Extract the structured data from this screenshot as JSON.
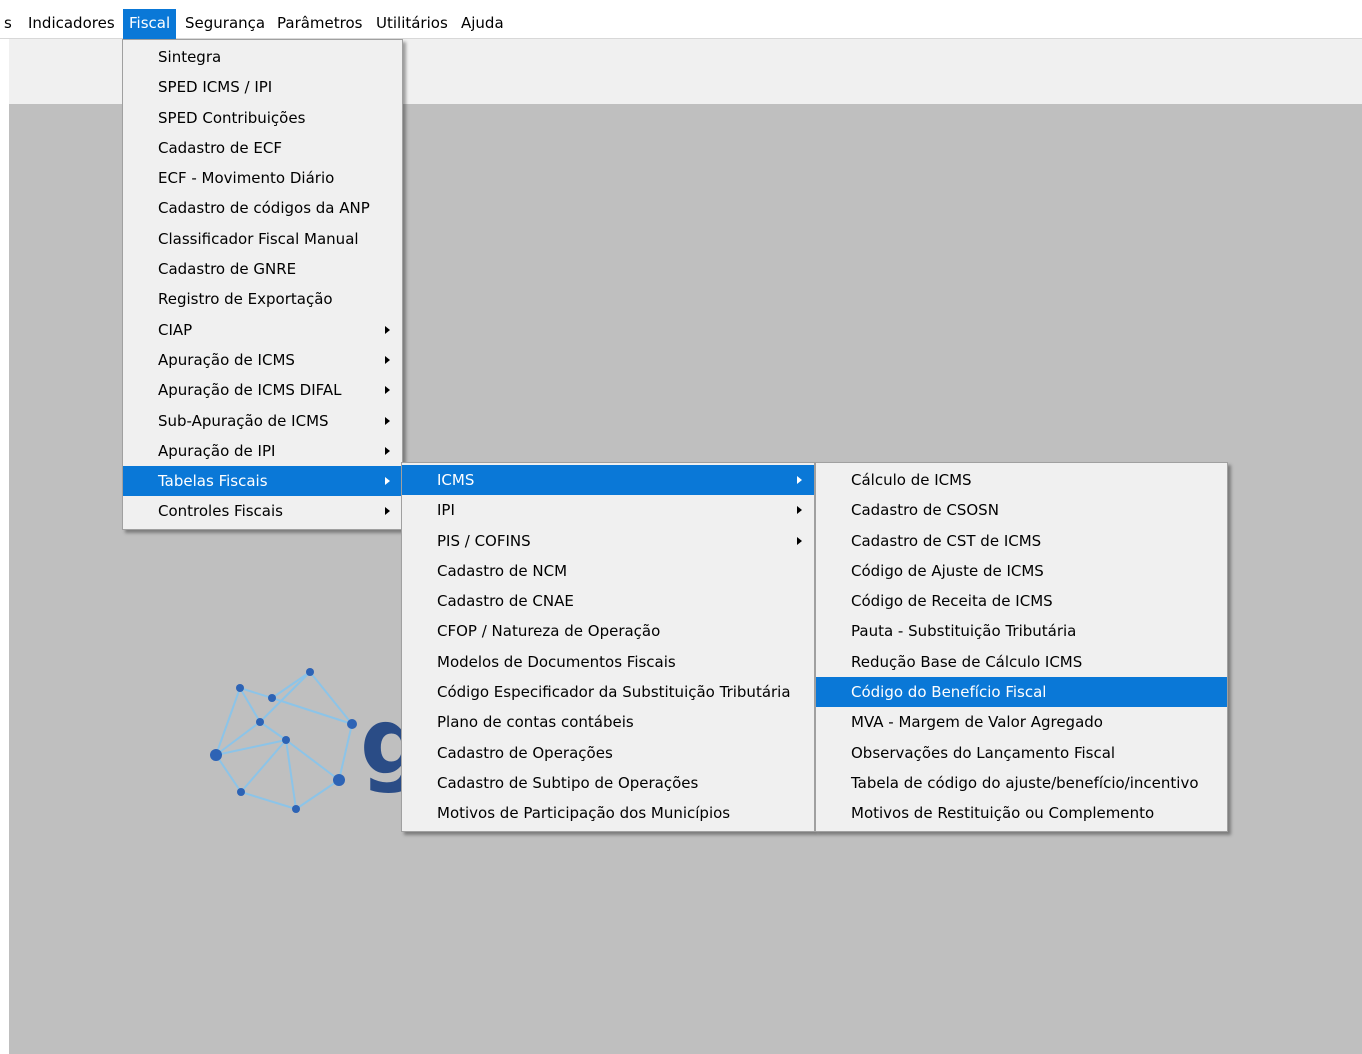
{
  "menubar": {
    "items": [
      {
        "label": "s"
      },
      {
        "label": "Indicadores"
      },
      {
        "label": "Fiscal"
      },
      {
        "label": "Segurança"
      },
      {
        "label": "Parâmetros"
      },
      {
        "label": "Utilitários"
      },
      {
        "label": "Ajuda"
      }
    ],
    "active_item": "Fiscal"
  },
  "fiscal_menu": {
    "items": [
      {
        "label": "Sintegra",
        "submenu": false
      },
      {
        "label": "SPED ICMS / IPI",
        "submenu": false
      },
      {
        "label": "SPED Contribuições",
        "submenu": false
      },
      {
        "label": "Cadastro de ECF",
        "submenu": false
      },
      {
        "label": "ECF - Movimento Diário",
        "submenu": false
      },
      {
        "label": "Cadastro de códigos da ANP",
        "submenu": false
      },
      {
        "label": "Classificador Fiscal Manual",
        "submenu": false
      },
      {
        "label": "Cadastro de GNRE",
        "submenu": false
      },
      {
        "label": "Registro de Exportação",
        "submenu": false
      },
      {
        "label": "CIAP",
        "submenu": true
      },
      {
        "label": "Apuração de ICMS",
        "submenu": true
      },
      {
        "label": "Apuração de ICMS DIFAL",
        "submenu": true
      },
      {
        "label": "Sub-Apuração de ICMS",
        "submenu": true
      },
      {
        "label": "Apuração de IPI",
        "submenu": true
      },
      {
        "label": "Tabelas Fiscais",
        "submenu": true,
        "active": true
      },
      {
        "label": "Controles Fiscais",
        "submenu": true
      }
    ]
  },
  "tabelas_fiscais_menu": {
    "items": [
      {
        "label": "ICMS",
        "submenu": true,
        "active": true
      },
      {
        "label": "IPI",
        "submenu": true
      },
      {
        "label": "PIS / COFINS",
        "submenu": true
      },
      {
        "label": "Cadastro de NCM",
        "submenu": false
      },
      {
        "label": "Cadastro de CNAE",
        "submenu": false
      },
      {
        "label": "CFOP / Natureza de Operação",
        "submenu": false
      },
      {
        "label": "Modelos de Documentos Fiscais",
        "submenu": false
      },
      {
        "label": "Código Especificador da Substituição Tributária",
        "submenu": false
      },
      {
        "label": "Plano de contas contábeis",
        "submenu": false
      },
      {
        "label": "Cadastro de Operações",
        "submenu": false
      },
      {
        "label": "Cadastro de Subtipo de Operações",
        "submenu": false
      },
      {
        "label": "Motivos de Participação dos Municípios",
        "submenu": false
      }
    ]
  },
  "icms_menu": {
    "items": [
      {
        "label": "Cálculo de ICMS",
        "submenu": false
      },
      {
        "label": "Cadastro de CSOSN",
        "submenu": false
      },
      {
        "label": "Cadastro de CST de ICMS",
        "submenu": false
      },
      {
        "label": "Código de Ajuste de ICMS",
        "submenu": false
      },
      {
        "label": "Código de Receita de ICMS",
        "submenu": false
      },
      {
        "label": "Pauta - Substituição Tributária",
        "submenu": false
      },
      {
        "label": "Redução Base de Cálculo ICMS",
        "submenu": false
      },
      {
        "label": "Código do Benefício Fiscal",
        "submenu": false,
        "active": true
      },
      {
        "label": "MVA - Margem de Valor Agregado",
        "submenu": false
      },
      {
        "label": "Observações do Lançamento Fiscal",
        "submenu": false
      },
      {
        "label": "Tabela de código do ajuste/benefício/incentivo",
        "submenu": false
      },
      {
        "label": "Motivos de Restituição ou Complemento",
        "submenu": false
      }
    ]
  },
  "logo": {
    "letter": "g"
  },
  "colors": {
    "highlight": "#0a78d7",
    "menu_bg": "#f0f0f0",
    "workspace_bg": "#bfbfbf",
    "logo_dark": "#2a4c86",
    "logo_dot": "#2d63b5",
    "logo_line": "#8cc4e8"
  }
}
